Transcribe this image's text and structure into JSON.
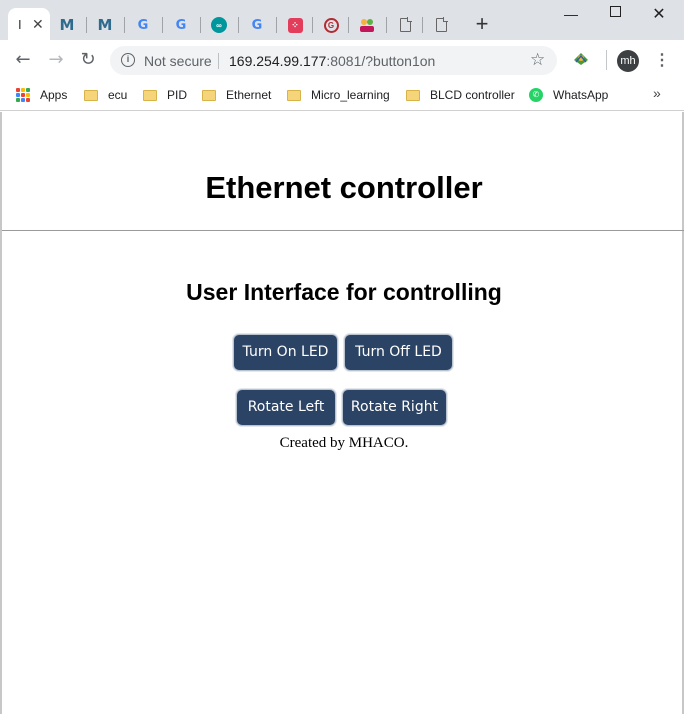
{
  "browser": {
    "active_tab_label": "I",
    "address": {
      "security_label": "Not secure",
      "host": "169.254.99.177",
      "rest": ":8081/?button1on"
    },
    "avatar_initials": "mh",
    "bookmarks": [
      {
        "label": "Apps",
        "icon": "apps-grid-icon"
      },
      {
        "label": "ecu",
        "icon": "folder-icon"
      },
      {
        "label": "PID",
        "icon": "folder-icon"
      },
      {
        "label": "Ethernet",
        "icon": "folder-icon"
      },
      {
        "label": "Micro_learning",
        "icon": "folder-icon"
      },
      {
        "label": "BLCD controller",
        "icon": "folder-icon"
      },
      {
        "label": "WhatsApp",
        "icon": "whatsapp-icon"
      }
    ],
    "tabs_icons": [
      "m-icon",
      "m-icon",
      "google-icon",
      "google-icon",
      "arduino-icon",
      "google-icon",
      "dice-icon",
      "g-circle-icon",
      "people-icon",
      "document-icon",
      "document-icon"
    ]
  },
  "page": {
    "title": "Ethernet controller",
    "subtitle": "User Interface for controlling",
    "buttons": {
      "led_on": "Turn On LED",
      "led_off": "Turn Off LED",
      "rotate_left": "Rotate Left",
      "rotate_right": "Rotate Right"
    },
    "credit": "Created by MHACO.",
    "button_color": "#2b4364"
  }
}
